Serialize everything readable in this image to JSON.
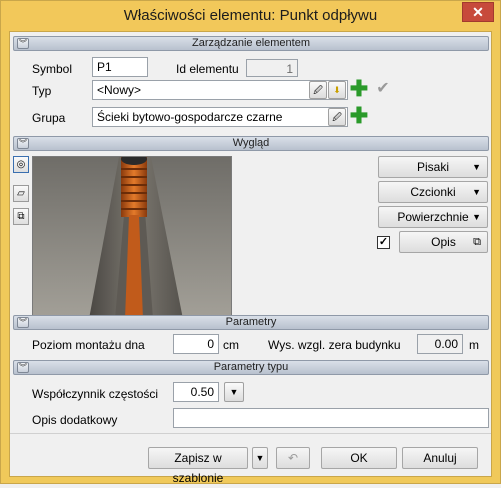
{
  "window": {
    "title": "Właściwości elementu: Punkt odpływu",
    "close_glyph": "✕"
  },
  "sections": {
    "zarzadzanie": "Zarządzanie elementem",
    "wyglad": "Wygląd",
    "parametry": "Parametry",
    "parametry_typu": "Parametry typu"
  },
  "management": {
    "symbol_label": "Symbol",
    "symbol_value": "P1",
    "id_label": "Id elementu",
    "id_value": "1",
    "typ_label": "Typ",
    "typ_value": "<Nowy>",
    "grupa_label": "Grupa",
    "grupa_value": "Ścieki bytowo-gospodarcze czarne"
  },
  "appearance": {
    "pisaki": "Pisaki",
    "czcionki": "Czcionki",
    "powierzchnie": "Powierzchnie",
    "opis": "Opis",
    "opis_checked": true
  },
  "params": {
    "poziom_label": "Poziom montażu dna",
    "poziom_value": "0",
    "poziom_unit": "cm",
    "wys_label": "Wys. wzgl. zera budynku",
    "wys_value": "0.00",
    "wys_unit": "m"
  },
  "type_params": {
    "wsp_label": "Współczynnik częstości",
    "wsp_value": "0.50",
    "opis_dod_label": "Opis dodatkowy",
    "opis_dod_value": ""
  },
  "footer": {
    "save_template": "Zapisz w szablonie",
    "ok": "OK",
    "cancel": "Anuluj"
  },
  "colors": {
    "titlebar": "#f2c85a",
    "close": "#c74a3b",
    "plus": "#2a9a2a",
    "pipe": "#d9641e"
  }
}
